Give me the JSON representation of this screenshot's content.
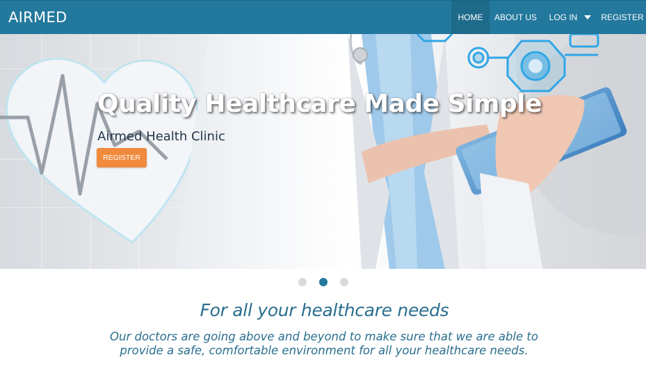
{
  "navbar": {
    "brand": "AIRMED",
    "items": [
      {
        "label": "HOME",
        "active": true
      },
      {
        "label": "ABOUT US",
        "active": false
      },
      {
        "label": "LOG IN",
        "active": false,
        "dropdown": true
      },
      {
        "label": "REGISTER",
        "active": false
      }
    ],
    "background": "#23789d"
  },
  "hero": {
    "title": "Quality Healthcare Made Simple",
    "subtitle": "Airmed Health Clinic",
    "button_label": "REGISTER",
    "button_color": "#f08a3c"
  },
  "carousel": {
    "slide_count": 3,
    "active_index": 1
  },
  "content": {
    "heading": "For all your healthcare needs",
    "text": "Our doctors are going above and beyond to make sure that we are able to provide a safe, comfortable environment for all your healthcare needs."
  },
  "colors": {
    "accent": "#23789d",
    "text": "#2a6e8e",
    "cta": "#f08a3c"
  }
}
